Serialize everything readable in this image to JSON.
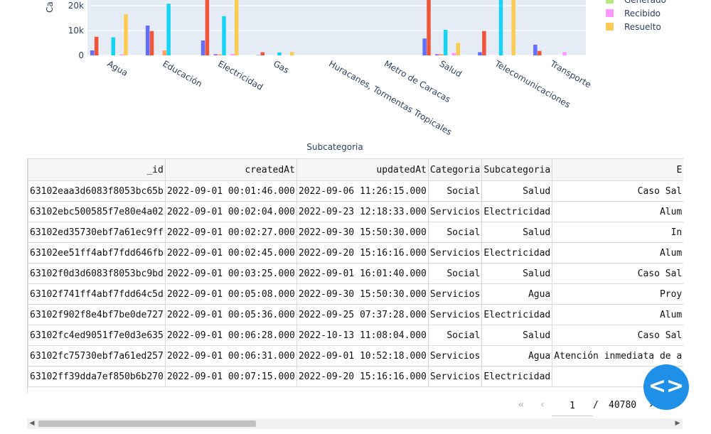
{
  "chart_data": {
    "type": "bar",
    "ylabel": "Ca",
    "xlabel": "Subcategoria",
    "ylim": [
      0,
      30000
    ],
    "yticks": [
      {
        "v": 0,
        "label": "0"
      },
      {
        "v": 10000,
        "label": "10k"
      },
      {
        "v": 20000,
        "label": "20k"
      }
    ],
    "categories": [
      "Agua",
      "Educación",
      "Electricidad",
      "Gas",
      "Huracanes, Tormentas Tropicales",
      "Metro de Caracas",
      "Salud",
      "Telecomunicaciones",
      "Transporte"
    ],
    "series": [
      {
        "name": "",
        "color": "#636efa",
        "values": [
          2000,
          12000,
          6000,
          100,
          0,
          0,
          6800,
          1300,
          4300
        ]
      },
      {
        "name": "",
        "color": "#ef553b",
        "values": [
          7500,
          9800,
          30000,
          1300,
          0,
          0,
          30000,
          9800,
          1800
        ]
      },
      {
        "name": "",
        "color": "#00cc96",
        "values": [
          0,
          0,
          0,
          0,
          0,
          0,
          0,
          0,
          0
        ]
      },
      {
        "name": "",
        "color": "#ab63fa",
        "values": [
          0,
          0,
          500,
          0,
          0,
          0,
          500,
          0,
          0
        ]
      },
      {
        "name": "",
        "color": "#ffa15a",
        "values": [
          0,
          2000,
          400,
          0,
          0,
          0,
          500,
          0,
          0
        ]
      },
      {
        "name": "",
        "color": "#19d3f3",
        "values": [
          7300,
          20800,
          15800,
          1200,
          0,
          0,
          10300,
          30000,
          0
        ]
      },
      {
        "name": "Generado",
        "color": "#b6e880",
        "values": [
          0,
          0,
          0,
          0,
          0,
          0,
          0,
          0,
          0
        ]
      },
      {
        "name": "Recibido",
        "color": "#ff97ff",
        "values": [
          400,
          0,
          600,
          0,
          0,
          0,
          1000,
          0,
          1300
        ]
      },
      {
        "name": "Resuelto",
        "color": "#fecb52",
        "values": [
          16500,
          0,
          30000,
          1400,
          0,
          0,
          5000,
          30000,
          0
        ]
      }
    ],
    "legend_position": "right"
  },
  "table": {
    "columns": [
      "_id",
      "createdAt",
      "updatedAt",
      "Categoria",
      "Subcategoria",
      "E"
    ],
    "rows": [
      [
        "63102eaa3d6083f8053bc65b",
        "2022-09-01 00:01:46.000",
        "2022-09-06 11:26:15.000",
        "Social",
        "Salud",
        "Caso Sal"
      ],
      [
        "63102ebc500585f7e80e4a02",
        "2022-09-01 00:02:04.000",
        "2022-09-23 12:18:33.000",
        "Servicios",
        "Electricidad",
        "Alum"
      ],
      [
        "63102ed35730ebf7a61ec9ff",
        "2022-09-01 00:02:27.000",
        "2022-09-30 15:50:30.000",
        "Social",
        "Salud",
        "In"
      ],
      [
        "63102ee51ff4abf7fdd646fb",
        "2022-09-01 00:02:45.000",
        "2022-09-20 15:16:16.000",
        "Servicios",
        "Electricidad",
        "Alum"
      ],
      [
        "63102f0d3d6083f8053bc9bd",
        "2022-09-01 00:03:25.000",
        "2022-09-01 16:01:40.000",
        "Social",
        "Salud",
        "Caso Sal"
      ],
      [
        "63102f741ff4abf7fdd64c5d",
        "2022-09-01 00:05:08.000",
        "2022-09-30 15:50:30.000",
        "Servicios",
        "Agua",
        "Proy"
      ],
      [
        "63102f902f8e4bf7be0de727",
        "2022-09-01 00:05:36.000",
        "2022-09-25 07:37:28.000",
        "Servicios",
        "Electricidad",
        "Alum"
      ],
      [
        "63102fc4ed9051f7e0d3e635",
        "2022-09-01 00:06:28.000",
        "2022-10-13 11:08:04.000",
        "Social",
        "Salud",
        "Caso Sal"
      ],
      [
        "63102fc75730ebf7a61ed257",
        "2022-09-01 00:06:31.000",
        "2022-09-01 10:52:18.000",
        "Servicios",
        "Agua",
        "Atención inmediata de a"
      ],
      [
        "63102ff39dda7ef850b6b270",
        "2022-09-01 00:07:15.000",
        "2022-09-20 15:16:16.000",
        "Servicios",
        "Electricidad",
        ""
      ]
    ]
  },
  "pager": {
    "current_page": "1",
    "separator": "/",
    "total_pages": "40780"
  },
  "icons": {
    "first": "first-page-icon",
    "prev": "previous-page-icon",
    "next": "next-page-icon",
    "last": "last-page-icon",
    "fab": "code-icon"
  }
}
